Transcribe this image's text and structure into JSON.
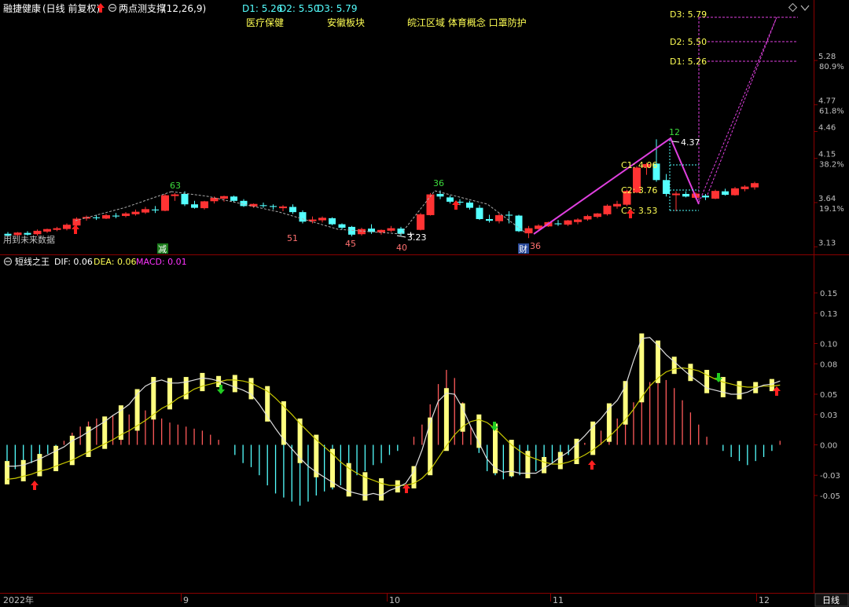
{
  "colors": {
    "up": "#ff3333",
    "down": "#54ffff",
    "neutral": "#ffffff",
    "dif": "#dddddd",
    "dea": "#c8c800",
    "macd_label": "#ff33ff",
    "axis_text": "#c0c0c0",
    "grid": "#8b0000",
    "magenta": "#e040e0",
    "yellow_text": "#ffff54",
    "cyan_text": "#54ffff",
    "arrow_red": "#ff2020",
    "arrow_green": "#22cc22",
    "hist_pos": "#ff5a5a",
    "hist_neg": "#54ffff",
    "hist_bar": "#ffff80"
  },
  "header": {
    "stock_name": "融捷健康",
    "period": "(日线 前复权)",
    "indicator_name": "两点测支撑",
    "indicator_params": "(12,26,9)",
    "d1": "D1: 5.26",
    "d2": "D2: 5.50",
    "d3": "D3: 5.79",
    "tags": [
      "医疗保健",
      "安徽板块",
      "皖江区域 体育概念 口罩防护"
    ]
  },
  "main_panel": {
    "note": "用到未来数据",
    "annotations": {
      "d3": "D3: 5.79",
      "d2": "D2: 5.50",
      "d1": "D1: 5.26",
      "c1": "C1: 4.06",
      "c2": "C2: 3.76",
      "c3": "C3: 3.53",
      "peak_value": "4.37",
      "low_value": "3.23",
      "count_12": "12",
      "count_63": "63",
      "count_36": "36",
      "count_51": "51",
      "count_45": "45",
      "count_40": "40",
      "count_36b": "36",
      "badge_jian": "减",
      "badge_cai": "财"
    }
  },
  "sub_panel": {
    "title": "短线之王",
    "dif": "DIF: 0.06",
    "dea": "DEA: 0.06",
    "macd": "MACD: 0.01"
  },
  "footer": {
    "year_label": "2022年",
    "month_labels": [
      "9",
      "10",
      "11",
      "12"
    ],
    "period_button": "日线"
  },
  "chart_data": [
    {
      "type": "candlestick",
      "title": "融捷健康 (日线 前复权)",
      "y_ticks": [
        {
          "price": "5.28",
          "pct": "80.9%"
        },
        {
          "price": "4.77",
          "pct": "61.8%"
        },
        {
          "price": "4.46",
          "pct": ""
        },
        {
          "price": "4.15",
          "pct": "38.2%"
        },
        {
          "price": "3.64",
          "pct": "19.1%"
        },
        {
          "price": "3.13",
          "pct": ""
        }
      ],
      "ylim": [
        3.08,
        5.8
      ],
      "candles": [
        {
          "o": 3.28,
          "h": 3.3,
          "l": 3.25,
          "c": 3.26
        },
        {
          "o": 3.27,
          "h": 3.3,
          "l": 3.25,
          "c": 3.29
        },
        {
          "o": 3.29,
          "h": 3.31,
          "l": 3.26,
          "c": 3.27
        },
        {
          "o": 3.28,
          "h": 3.33,
          "l": 3.26,
          "c": 3.31
        },
        {
          "o": 3.31,
          "h": 3.34,
          "l": 3.29,
          "c": 3.33
        },
        {
          "o": 3.33,
          "h": 3.36,
          "l": 3.31,
          "c": 3.34
        },
        {
          "o": 3.34,
          "h": 3.4,
          "l": 3.32,
          "c": 3.38
        },
        {
          "o": 3.38,
          "h": 3.47,
          "l": 3.36,
          "c": 3.45
        },
        {
          "o": 3.46,
          "h": 3.49,
          "l": 3.43,
          "c": 3.47
        },
        {
          "o": 3.47,
          "h": 3.5,
          "l": 3.44,
          "c": 3.46
        },
        {
          "o": 3.46,
          "h": 3.51,
          "l": 3.45,
          "c": 3.49
        },
        {
          "o": 3.49,
          "h": 3.52,
          "l": 3.46,
          "c": 3.48
        },
        {
          "o": 3.49,
          "h": 3.53,
          "l": 3.47,
          "c": 3.51
        },
        {
          "o": 3.51,
          "h": 3.56,
          "l": 3.49,
          "c": 3.53
        },
        {
          "o": 3.53,
          "h": 3.59,
          "l": 3.51,
          "c": 3.56
        },
        {
          "o": 3.56,
          "h": 3.6,
          "l": 3.52,
          "c": 3.55
        },
        {
          "o": 3.55,
          "h": 3.74,
          "l": 3.54,
          "c": 3.72
        },
        {
          "o": 3.72,
          "h": 3.75,
          "l": 3.66,
          "c": 3.73
        },
        {
          "o": 3.74,
          "h": 3.77,
          "l": 3.6,
          "c": 3.62
        },
        {
          "o": 3.62,
          "h": 3.66,
          "l": 3.57,
          "c": 3.58
        },
        {
          "o": 3.58,
          "h": 3.66,
          "l": 3.56,
          "c": 3.65
        },
        {
          "o": 3.66,
          "h": 3.71,
          "l": 3.63,
          "c": 3.69
        },
        {
          "o": 3.69,
          "h": 3.72,
          "l": 3.65,
          "c": 3.71
        },
        {
          "o": 3.71,
          "h": 3.72,
          "l": 3.64,
          "c": 3.66
        },
        {
          "o": 3.66,
          "h": 3.68,
          "l": 3.59,
          "c": 3.6
        },
        {
          "o": 3.6,
          "h": 3.63,
          "l": 3.58,
          "c": 3.62
        },
        {
          "o": 3.61,
          "h": 3.64,
          "l": 3.58,
          "c": 3.6
        },
        {
          "o": 3.6,
          "h": 3.62,
          "l": 3.56,
          "c": 3.59
        },
        {
          "o": 3.58,
          "h": 3.61,
          "l": 3.54,
          "c": 3.59
        },
        {
          "o": 3.59,
          "h": 3.62,
          "l": 3.51,
          "c": 3.53
        },
        {
          "o": 3.53,
          "h": 3.55,
          "l": 3.4,
          "c": 3.42
        },
        {
          "o": 3.43,
          "h": 3.48,
          "l": 3.4,
          "c": 3.44
        },
        {
          "o": 3.44,
          "h": 3.48,
          "l": 3.41,
          "c": 3.46
        },
        {
          "o": 3.46,
          "h": 3.47,
          "l": 3.38,
          "c": 3.39
        },
        {
          "o": 3.39,
          "h": 3.4,
          "l": 3.33,
          "c": 3.35
        },
        {
          "o": 3.36,
          "h": 3.37,
          "l": 3.25,
          "c": 3.27
        },
        {
          "o": 3.28,
          "h": 3.35,
          "l": 3.26,
          "c": 3.33
        },
        {
          "o": 3.34,
          "h": 3.39,
          "l": 3.28,
          "c": 3.3
        },
        {
          "o": 3.3,
          "h": 3.33,
          "l": 3.27,
          "c": 3.32
        },
        {
          "o": 3.32,
          "h": 3.37,
          "l": 3.3,
          "c": 3.34
        },
        {
          "o": 3.34,
          "h": 3.36,
          "l": 3.26,
          "c": 3.28
        },
        {
          "o": 3.28,
          "h": 3.3,
          "l": 3.24,
          "c": 3.28
        },
        {
          "o": 3.33,
          "h": 3.52,
          "l": 3.32,
          "c": 3.5
        },
        {
          "o": 3.5,
          "h": 3.75,
          "l": 3.49,
          "c": 3.73
        },
        {
          "o": 3.74,
          "h": 3.78,
          "l": 3.68,
          "c": 3.71
        },
        {
          "o": 3.7,
          "h": 3.72,
          "l": 3.63,
          "c": 3.65
        },
        {
          "o": 3.65,
          "h": 3.68,
          "l": 3.61,
          "c": 3.64
        },
        {
          "o": 3.64,
          "h": 3.66,
          "l": 3.56,
          "c": 3.58
        },
        {
          "o": 3.58,
          "h": 3.61,
          "l": 3.44,
          "c": 3.45
        },
        {
          "o": 3.45,
          "h": 3.5,
          "l": 3.41,
          "c": 3.43
        },
        {
          "o": 3.43,
          "h": 3.52,
          "l": 3.4,
          "c": 3.49
        },
        {
          "o": 3.5,
          "h": 3.54,
          "l": 3.4,
          "c": 3.49
        },
        {
          "o": 3.49,
          "h": 3.5,
          "l": 3.3,
          "c": 3.31
        },
        {
          "o": 3.29,
          "h": 3.37,
          "l": 3.23,
          "c": 3.34
        },
        {
          "o": 3.34,
          "h": 3.39,
          "l": 3.33,
          "c": 3.37
        },
        {
          "o": 3.37,
          "h": 3.42,
          "l": 3.36,
          "c": 3.41
        },
        {
          "o": 3.4,
          "h": 3.44,
          "l": 3.37,
          "c": 3.39
        },
        {
          "o": 3.39,
          "h": 3.44,
          "l": 3.37,
          "c": 3.43
        },
        {
          "o": 3.42,
          "h": 3.46,
          "l": 3.39,
          "c": 3.44
        },
        {
          "o": 3.45,
          "h": 3.5,
          "l": 3.43,
          "c": 3.48
        },
        {
          "o": 3.48,
          "h": 3.52,
          "l": 3.46,
          "c": 3.51
        },
        {
          "o": 3.51,
          "h": 3.62,
          "l": 3.49,
          "c": 3.6
        },
        {
          "o": 3.6,
          "h": 3.66,
          "l": 3.57,
          "c": 3.62
        },
        {
          "o": 3.62,
          "h": 3.79,
          "l": 3.6,
          "c": 3.77
        },
        {
          "o": 3.76,
          "h": 4.06,
          "l": 3.75,
          "c": 4.04
        },
        {
          "o": 4.05,
          "h": 4.1,
          "l": 3.96,
          "c": 4.08
        },
        {
          "o": 4.09,
          "h": 4.37,
          "l": 3.88,
          "c": 3.9
        },
        {
          "o": 3.9,
          "h": 3.97,
          "l": 3.71,
          "c": 3.74
        },
        {
          "o": 3.73,
          "h": 3.77,
          "l": 3.54,
          "c": 3.74
        },
        {
          "o": 3.74,
          "h": 3.77,
          "l": 3.7,
          "c": 3.71
        },
        {
          "o": 3.7,
          "h": 3.76,
          "l": 3.68,
          "c": 3.74
        },
        {
          "o": 3.72,
          "h": 3.74,
          "l": 3.67,
          "c": 3.7
        },
        {
          "o": 3.69,
          "h": 3.79,
          "l": 3.68,
          "c": 3.77
        },
        {
          "o": 3.77,
          "h": 3.8,
          "l": 3.72,
          "c": 3.73
        },
        {
          "o": 3.73,
          "h": 3.82,
          "l": 3.72,
          "c": 3.8
        },
        {
          "o": 3.8,
          "h": 3.84,
          "l": 3.77,
          "c": 3.82
        },
        {
          "o": 3.82,
          "h": 3.88,
          "l": 3.79,
          "c": 3.86
        }
      ]
    },
    {
      "type": "macd",
      "title": "短线之王",
      "y_ticks": [
        "0.15",
        "0.13",
        "0.10",
        "0.08",
        "0.05",
        "0.03",
        "0.00",
        "-0.03",
        "-0.05"
      ],
      "ylim": [
        -0.075,
        0.17
      ],
      "dif": [
        -0.021,
        -0.021,
        -0.02,
        -0.017,
        -0.014,
        -0.01,
        -0.006,
        -0.002,
        0.004,
        0.008,
        0.013,
        0.018,
        0.023,
        0.029,
        0.034,
        0.04,
        0.05,
        0.058,
        0.062,
        0.064,
        0.061,
        0.061,
        0.062,
        0.064,
        0.066,
        0.065,
        0.063,
        0.06,
        0.057,
        0.054,
        0.05,
        0.04,
        0.028,
        0.016,
        0.005,
        -0.004,
        -0.013,
        -0.021,
        -0.027,
        -0.032,
        -0.037,
        -0.042,
        -0.046,
        -0.048,
        -0.05,
        -0.048,
        -0.05,
        -0.045,
        -0.042,
        -0.038,
        -0.026,
        -0.005,
        0.022,
        0.043,
        0.051,
        0.05,
        0.036,
        0.018,
        0.002,
        -0.014,
        -0.023,
        -0.027,
        -0.026,
        -0.028,
        -0.028,
        -0.028,
        -0.023,
        -0.018,
        -0.012,
        -0.007,
        0.001,
        0.009,
        0.018,
        0.026,
        0.036,
        0.044,
        0.058,
        0.083,
        0.105,
        0.106,
        0.098,
        0.089,
        0.082,
        0.075,
        0.068,
        0.062,
        0.056,
        0.054,
        0.052,
        0.05,
        0.05,
        0.052,
        0.056,
        0.059,
        0.06,
        0.063
      ],
      "dea": [
        -0.034,
        -0.033,
        -0.031,
        -0.029,
        -0.026,
        -0.024,
        -0.021,
        -0.018,
        -0.015,
        -0.011,
        -0.007,
        -0.003,
        0.001,
        0.005,
        0.01,
        0.014,
        0.019,
        0.024,
        0.03,
        0.036,
        0.04,
        0.046,
        0.05,
        0.055,
        0.058,
        0.06,
        0.062,
        0.064,
        0.064,
        0.063,
        0.061,
        0.057,
        0.053,
        0.046,
        0.038,
        0.03,
        0.021,
        0.013,
        0.005,
        -0.002,
        -0.009,
        -0.017,
        -0.023,
        -0.028,
        -0.032,
        -0.035,
        -0.038,
        -0.04,
        -0.04,
        -0.04,
        -0.038,
        -0.033,
        -0.025,
        -0.013,
        -0.001,
        0.01,
        0.018,
        0.023,
        0.025,
        0.022,
        0.016,
        0.008,
        0.0,
        -0.006,
        -0.011,
        -0.014,
        -0.017,
        -0.019,
        -0.019,
        -0.017,
        -0.014,
        -0.01,
        -0.005,
        0.001,
        0.008,
        0.016,
        0.025,
        0.035,
        0.047,
        0.058,
        0.066,
        0.072,
        0.075,
        0.076,
        0.075,
        0.073,
        0.069,
        0.065,
        0.062,
        0.06,
        0.058,
        0.057,
        0.057,
        0.058,
        0.058,
        0.059
      ],
      "macd_hist": [
        -0.027,
        -0.024,
        -0.022,
        -0.018,
        -0.014,
        -0.009,
        -0.003,
        0.004,
        0.012,
        0.018,
        0.023,
        0.026,
        0.028,
        0.029,
        0.029,
        0.03,
        0.036,
        0.034,
        0.03,
        0.026,
        0.022,
        0.02,
        0.018,
        0.016,
        0.014,
        0.01,
        0.005,
        0.0,
        -0.01,
        -0.018,
        -0.022,
        -0.03,
        -0.04,
        -0.048,
        -0.052,
        -0.056,
        -0.06,
        -0.056,
        -0.05,
        -0.046,
        -0.044,
        -0.04,
        -0.036,
        -0.03,
        -0.026,
        -0.02,
        -0.018,
        -0.01,
        -0.006,
        0.0,
        0.008,
        0.02,
        0.04,
        0.06,
        0.074,
        0.066,
        0.042,
        0.018,
        -0.008,
        -0.026,
        -0.03,
        -0.034,
        -0.032,
        -0.03,
        -0.028,
        -0.026,
        -0.022,
        -0.018,
        -0.014,
        -0.01,
        -0.004,
        0.002,
        0.008,
        0.014,
        0.02,
        0.026,
        0.033,
        0.042,
        0.052,
        0.062,
        0.068,
        0.064,
        0.056,
        0.044,
        0.032,
        0.02,
        0.008,
        0.0,
        -0.006,
        -0.012,
        -0.016,
        -0.02,
        -0.016,
        -0.012,
        -0.006,
        0.004
      ]
    }
  ]
}
